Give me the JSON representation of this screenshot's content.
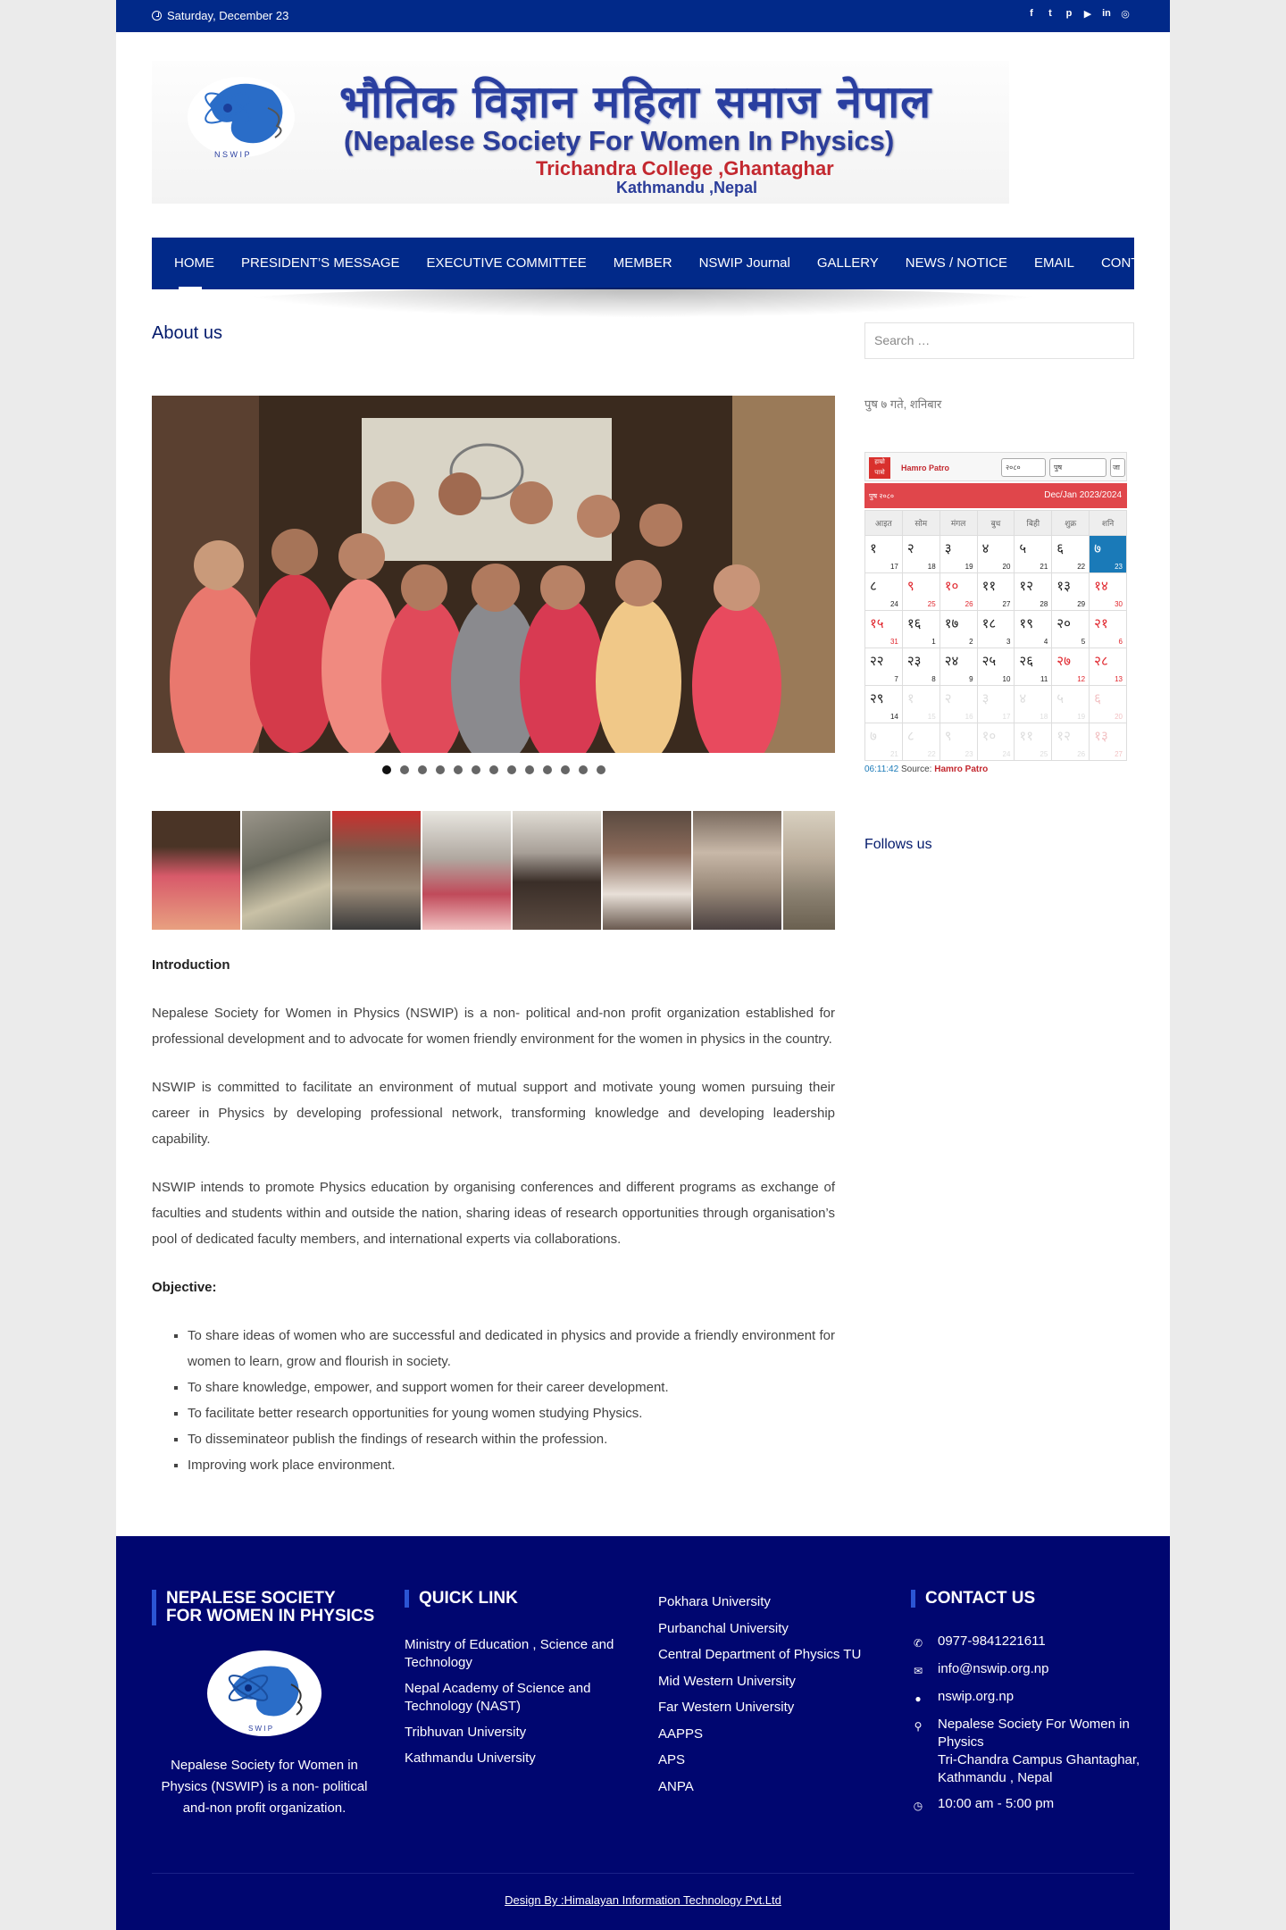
{
  "topbar": {
    "date": "Saturday, December 23",
    "social": [
      "f",
      "t",
      "p",
      "▶",
      "in",
      "◎"
    ]
  },
  "banner": {
    "line1": "भौतिक विज्ञान महिला समाज नेपाल",
    "line2": "(Nepalese Society For Women In Physics)",
    "line3": "Trichandra College ,Ghantaghar",
    "line4": "Kathmandu ,Nepal"
  },
  "nav": {
    "items": [
      "HOME",
      "PRESIDENT’S MESSAGE",
      "EXECUTIVE COMMITTEE",
      "MEMBER",
      "NSWIP Journal",
      "GALLERY",
      "NEWS / NOTICE",
      "EMAIL",
      "CONTACT"
    ]
  },
  "main": {
    "heading": "About us",
    "slider_dots": 13,
    "active_dot": 0,
    "intro_heading": "Introduction",
    "paragraphs": [
      "Nepalese Society for Women in Physics (NSWIP) is a non- political and-non profit organization established for professional development and to advocate for women friendly environment for the women in physics in the country.",
      "NSWIP is committed to facilitate an environment of mutual support and motivate young women pursuing their career in Physics by developing professional network, transforming knowledge and developing leadership capability.",
      "NSWIP intends to promote Physics education by organising conferences and different programs as exchange of faculties and students within and outside the nation, sharing ideas of research opportunities through organisation’s pool of dedicated faculty members, and international experts via collaborations."
    ],
    "objective_heading": "Objective:",
    "objectives": [
      "To share ideas of women who are successful and dedicated in physics and provide a friendly environment for women to learn, grow and flourish in society.",
      "To share knowledge, empower, and support women for their career development.",
      "To facilitate better research opportunities for young women studying Physics.",
      "To disseminateor publish the findings of research within the profession.",
      "Improving work place environment."
    ]
  },
  "sidebar": {
    "search_placeholder": "Search …",
    "nepali_date": "पुष ७ गते, शनिबार",
    "calendar": {
      "brand": "Hamro Patro",
      "brand_icon_text": "हाम्रो पात्रो",
      "select_year": "२०८०",
      "select_month": "पुष",
      "go": "जा",
      "head_left": "पुष २०८०",
      "head_right": "Dec/Jan 2023/2024",
      "weekdays": [
        "आइत",
        "सोम",
        "मंगल",
        "बुध",
        "बिही",
        "शुक्र",
        "शनि"
      ],
      "cells": [
        {
          "np": "१",
          "en": "17"
        },
        {
          "np": "२",
          "en": "18"
        },
        {
          "np": "३",
          "en": "19"
        },
        {
          "np": "४",
          "en": "20"
        },
        {
          "np": "५",
          "en": "21"
        },
        {
          "np": "६",
          "en": "22"
        },
        {
          "np": "७",
          "en": "23",
          "today": true
        },
        {
          "np": "८",
          "en": "24"
        },
        {
          "np": "९",
          "en": "25",
          "hol": true
        },
        {
          "np": "१०",
          "en": "26",
          "hol": true
        },
        {
          "np": "११",
          "en": "27"
        },
        {
          "np": "१२",
          "en": "28"
        },
        {
          "np": "१३",
          "en": "29"
        },
        {
          "np": "१४",
          "en": "30",
          "hol": true
        },
        {
          "np": "१५",
          "en": "31",
          "hol": true
        },
        {
          "np": "१६",
          "en": "1"
        },
        {
          "np": "१७",
          "en": "2"
        },
        {
          "np": "१८",
          "en": "3"
        },
        {
          "np": "१९",
          "en": "4"
        },
        {
          "np": "२०",
          "en": "5"
        },
        {
          "np": "२१",
          "en": "6",
          "hol": true
        },
        {
          "np": "२२",
          "en": "7"
        },
        {
          "np": "२३",
          "en": "8"
        },
        {
          "np": "२४",
          "en": "9"
        },
        {
          "np": "२५",
          "en": "10"
        },
        {
          "np": "२६",
          "en": "11"
        },
        {
          "np": "२७",
          "en": "12",
          "hol": true
        },
        {
          "np": "२८",
          "en": "13",
          "hol": true
        },
        {
          "np": "२९",
          "en": "14"
        },
        {
          "np": "१",
          "en": "15",
          "fade": true
        },
        {
          "np": "२",
          "en": "16",
          "fade": true
        },
        {
          "np": "३",
          "en": "17",
          "fade": true
        },
        {
          "np": "४",
          "en": "18",
          "fade": true
        },
        {
          "np": "५",
          "en": "19",
          "fade": true
        },
        {
          "np": "६",
          "en": "20",
          "fade": true,
          "hol": true
        },
        {
          "np": "७",
          "en": "21",
          "fade": true
        },
        {
          "np": "८",
          "en": "22",
          "fade": true
        },
        {
          "np": "९",
          "en": "23",
          "fade": true
        },
        {
          "np": "१०",
          "en": "24",
          "fade": true
        },
        {
          "np": "११",
          "en": "25",
          "fade": true
        },
        {
          "np": "१२",
          "en": "26",
          "fade": true
        },
        {
          "np": "१३",
          "en": "27",
          "fade": true,
          "hol": true
        }
      ],
      "time": "06:11:42",
      "source_label": "Source:",
      "source_name": "Hamro Patro"
    },
    "follows": "Follows us"
  },
  "footer": {
    "col1_title": "NEPALESE SOCIETY FOR WOMEN IN PHYSICS",
    "col1_text": "Nepalese Society for Women in Physics (NSWIP) is a non- political and-non profit organization.",
    "col2_title": "QUICK LINK",
    "quick_links": [
      "Ministry of Education , Science and Technology",
      "Nepal Academy of Science and Technology (NAST)",
      "Tribhuvan University",
      "Kathmandu University"
    ],
    "col3_links": [
      "Pokhara University",
      "Purbanchal University",
      "Central Department of Physics TU",
      "Mid Western University",
      "Far Western University",
      "AAPPS",
      "APS",
      "ANPA"
    ],
    "col4_title": "CONTACT US",
    "contact": {
      "phone": "0977-9841221611",
      "email": "info@nswip.org.np",
      "website": "nswip.org.np",
      "address_line1": "Nepalese Society For Women in Physics",
      "address_line2": "Tri-Chandra Campus Ghantaghar, Kathmandu , Nepal",
      "hours": "10:00 am - 5:00 pm"
    },
    "credit": "Design By :Himalayan Information Technology Pvt.Ltd"
  },
  "colors": {
    "primary_blue": "#012989",
    "footer_navy": "#000670",
    "heading_navy": "#031a6c",
    "calendar_red": "#e0464b",
    "calendar_today": "#1a7ab8"
  }
}
